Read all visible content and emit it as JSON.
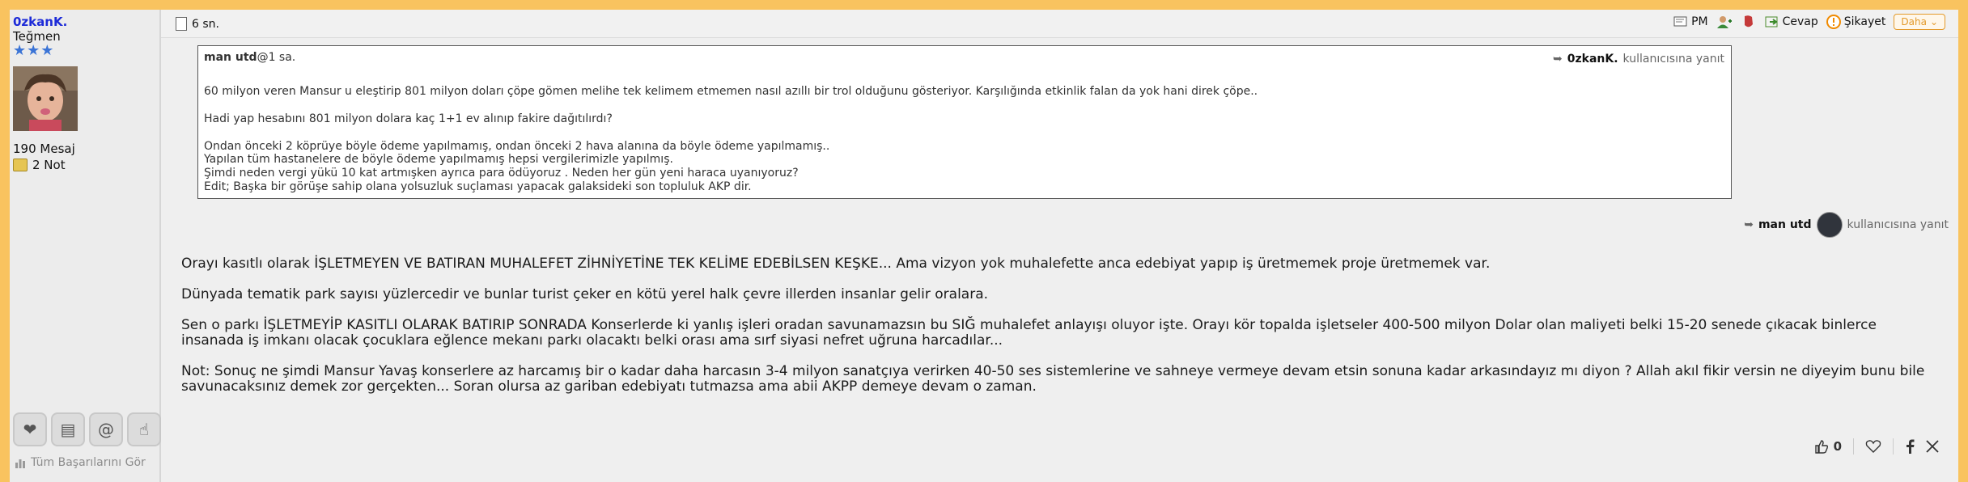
{
  "user": {
    "name": "0zkanK.",
    "rank": "Teğmen",
    "stars": "★★★",
    "messages": "190 Mesaj",
    "notes": "2 Not",
    "achievements_link": "Tüm Başarılarını Gör"
  },
  "post": {
    "timestamp": "6 sn.",
    "actions": {
      "pm": "PM",
      "reply": "Cevap",
      "complaint": "Şikayet",
      "more": "Daha"
    },
    "quote": {
      "author": "man utd",
      "time": "@1 sa.",
      "reply_to_name": "0zkanK.",
      "reply_to_suffix": "kullanıcısına yanıt",
      "paragraphs": [
        "60 milyon veren Mansur u eleştirip 801 milyon doları çöpe gömen melihe tek kelimem etmemen nasıl azıllı bir trol olduğunu gösteriyor. Karşılığında etkinlik falan da yok hani direk çöpe..",
        "Hadi yap hesabını 801 milyon dolara kaç 1+1 ev alınıp fakire dağıtılırdı?"
      ],
      "lines": [
        "Ondan önceki 2 köprüye böyle ödeme yapılmamış, ondan önceki 2 hava alanına da böyle ödeme yapılmamış..",
        "Yapılan tüm hastanelere de böyle ödeme yapılmamış hepsi vergilerimizle yapılmış.",
        "Şimdi neden vergi yükü 10 kat artmışken ayrıca para ödüyoruz . Neden her gün yeni haraca uyanıyoruz?",
        "Edit; Başka bir görüşe sahip olana yolsuzluk suçlaması yapacak galaksideki son topluluk AKP dir."
      ]
    },
    "reply_to": {
      "name": "man utd",
      "suffix": "kullanıcısına yanıt"
    },
    "body": [
      "Orayı kasıtlı olarak İŞLETMEYEN VE BATIRAN MUHALEFET ZİHNİYETİNE TEK KELİME EDEBİLSEN KEŞKE... Ama vizyon yok muhalefette anca edebiyat yapıp iş üretmemek proje üretmemek var.",
      "Dünyada tematik park sayısı yüzlercedir ve bunlar turist çeker en kötü yerel halk çevre illerden insanlar gelir oralara.",
      "Sen o parkı İŞLETMEYİP KASITLI OLARAK BATIRIP SONRADA Konserlerde ki yanlış işleri oradan savunamazsın bu SIĞ muhalefet anlayışı oluyor işte. Orayı kör topalda işletseler 400-500 milyon Dolar olan maliyeti belki 15-20 senede çıkacak binlerce insanada iş imkanı olacak çocuklara eğlence mekanı parkı olacaktı belki orası ama sırf siyasi nefret uğruna harcadılar...",
      "Not: Sonuç ne şimdi Mansur Yavaş konserlere az harcamış bir o kadar daha harcasın 3-4 milyon sanatçıya verirken 40-50 ses sistemlerine ve sahneye vermeye devam etsin sonuna kadar arkasındayız mı diyon ? Allah akıl fikir versin ne diyeyim bunu bile savunacaksınız demek zor gerçekten... Soran olursa az gariban edebiyatı tutmazsa ama abii AKPP demeye devam o zaman."
    ],
    "likes": "0"
  },
  "colors": {
    "accent": "#f9c35f",
    "username": "#1d2bd8",
    "more": "#e39a2b"
  }
}
